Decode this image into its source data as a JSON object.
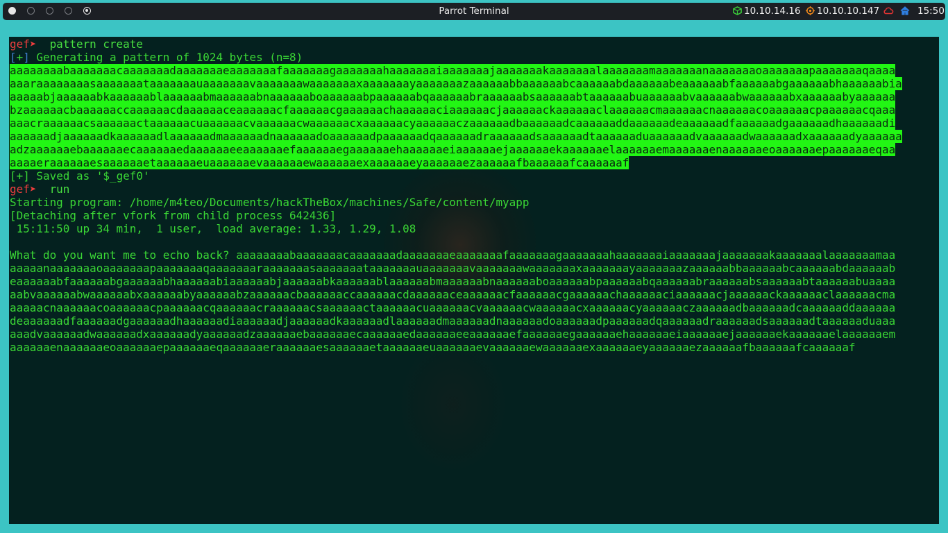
{
  "window": {
    "title": "Parrot Terminal"
  },
  "tray": {
    "ip_vpn": "10.10.14.16",
    "ip_target": "10.10.10.147",
    "time": "15:50"
  },
  "terminal": {
    "prompt": "gef➤ ",
    "cmd1": " pattern create",
    "bracket_open": "[",
    "plus": "+",
    "bracket_close": "]",
    "generating": " Generating a pattern of 1024 bytes (n=8)",
    "pattern_lines": [
      "aaaaaaaabaaaaaaacaaaaaaadaaaaaaaeaaaaaaafaaaaaaagaaaaaaahaaaaaaaiaaaaaaajaaaaaaakaaaaaaalaaaaaaamaaaaaaanaaaaaaaoaaaaaaapaaaaaaaqaaaa",
      "aaaraaaaaaaasaaaaaaataaaaaaauaaaaaaavaaaaaaawaaaaaaaxaaaaaaayaaaaaaazaaaaaabbaaaaaabcaaaaaabdaaaaaabeaaaaaabfaaaaaabgaaaaaabhaaaaaabia",
      "aaaaabjaaaaaabkaaaaaablaaaaaabmaaaaaabnaaaaaaboaaaaaabpaaaaaabqaaaaaabraaaaaabsaaaaaabtaaaaaabuaaaaaabvaaaaaabwaaaaaabxaaaaaabyaaaaaa",
      "bzaaaaaacbaaaaaaccaaaaaacdaaaaaaceaaaaaacfaaaaaacgaaaaaachaaaaaaciaaaaaacjaaaaaackaaaaaaclaaaaaacmaaaaaacnaaaaaacoaaaaaacpaaaaaacqaaa",
      "aaacraaaaaacsaaaaaactaaaaaacuaaaaaacvaaaaaacwaaaaaacxaaaaaacyaaaaaaczaaaaaadbaaaaaadcaaaaaaddaaaaaadeaaaaaadfaaaaaadgaaaaaadhaaaaaadi",
      "aaaaaadjaaaaaadkaaaaaadlaaaaaadmaaaaaadnaaaaaadoaaaaaadpaaaaaadqaaaaaadraaaaaadsaaaaaadtaaaaaaduaaaaaadvaaaaaadwaaaaaadxaaaaaadyaaaaaa",
      "adzaaaaaaebaaaaaaecaaaaaaedaaaaaaeeaaaaaaefaaaaaaegaaaaaaehaaaaaaeiaaaaaaejaaaaaaekaaaaaaelaaaaaaemaaaaaaenaaaaaaeoaaaaaaepaaaaaaeqaa",
      "aaaaeraaaaaaesaaaaaaetaaaaaaeuaaaaaaevaaaaaaewaaaaaaexaaaaaaeyaaaaaaezaaaaaafbaaaaaafcaaaaaaf"
    ],
    "saved": " Saved as '$_gef0'",
    "cmd2": " run",
    "starting": "Starting program: /home/m4teo/Documents/hackTheBox/machines/Safe/content/myapp",
    "detaching": "[Detaching after vfork from child process 642436]",
    "uptime": " 15:11:50 up 34 min,  1 user,  load average: 1.33, 1.29, 1.08",
    "echo_lines": [
      "What do you want me to echo back? aaaaaaaabaaaaaaacaaaaaaadaaaaaaaeaaaaaaafaaaaaaagaaaaaaahaaaaaaaiaaaaaaajaaaaaaakaaaaaaalaaaaaaamaa",
      "aaaaanaaaaaaaoaaaaaaapaaaaaaaqaaaaaaaraaaaaaasaaaaaaataaaaaaauaaaaaaavaaaaaaawaaaaaaaxaaaaaaayaaaaaaazaaaaaabbaaaaaabcaaaaaabdaaaaaab",
      "eaaaaaabfaaaaaabgaaaaaabhaaaaaabiaaaaaabjaaaaaabkaaaaaablaaaaaabmaaaaaabnaaaaaaboaaaaaabpaaaaaabqaaaaaabraaaaaabsaaaaaabtaaaaaabuaaaa",
      "aabvaaaaaabwaaaaaabxaaaaaabyaaaaaabzaaaaaacbaaaaaaccaaaaaacdaaaaaaceaaaaaacfaaaaaacgaaaaaachaaaaaaciaaaaaacjaaaaaackaaaaaaclaaaaaacma",
      "aaaaacnaaaaaacoaaaaaacpaaaaaacqaaaaaacraaaaaacsaaaaaactaaaaaacuaaaaaacvaaaaaacwaaaaaacxaaaaaacyaaaaaaczaaaaaadbaaaaaadcaaaaaaddaaaaaa",
      "deaaaaaadfaaaaaadgaaaaaadhaaaaaadiaaaaaadjaaaaaadkaaaaaadlaaaaaadmaaaaaadnaaaaaadoaaaaaadpaaaaaadqaaaaaadraaaaaadsaaaaaadtaaaaaaduaaa",
      "aaadvaaaaaadwaaaaaadxaaaaaadyaaaaaadzaaaaaaebaaaaaaecaaaaaaedaaaaaaeeaaaaaaefaaaaaaegaaaaaaehaaaaaaeiaaaaaaejaaaaaaekaaaaaaelaaaaaaem",
      "aaaaaaenaaaaaaeoaaaaaaepaaaaaaeqaaaaaaeraaaaaaesaaaaaaetaaaaaaeuaaaaaaevaaaaaaewaaaaaaexaaaaaaeyaaaaaaezaaaaaafbaaaaaafcaaaaaaf"
    ]
  }
}
